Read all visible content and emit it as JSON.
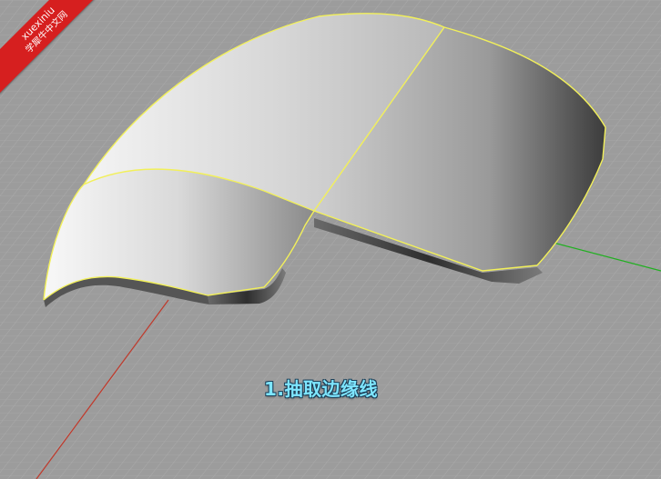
{
  "viewport": {
    "caption": "1.抽取边缘线",
    "colors": {
      "background": "#9c9c9c",
      "grid_minor": "#a9a9a9",
      "grid_major": "#b3b3b3",
      "x_axis": "#c0392b",
      "y_axis": "#20b020",
      "edge_highlight": "#f2f05a",
      "caption_text": "#7ee6ff"
    }
  },
  "watermark": {
    "line1": "xuexiniu",
    "line2": "学犀牛中文网",
    "color": "#d61f1f"
  }
}
